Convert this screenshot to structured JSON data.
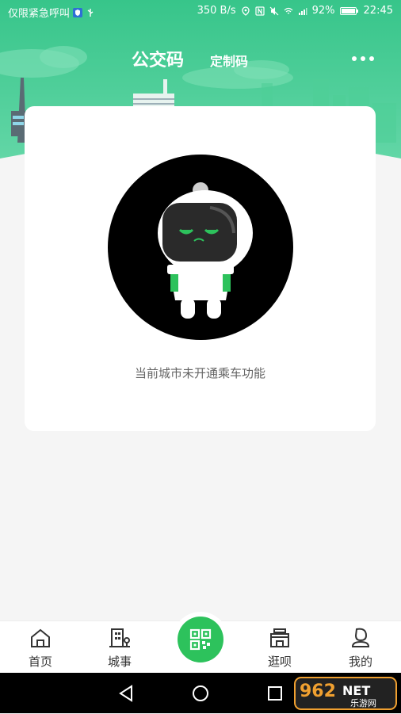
{
  "status_bar": {
    "carrier_text": "仅限紧急呼叫",
    "network_speed": "350 B/s",
    "battery": "92%",
    "time": "22:45"
  },
  "header": {
    "title": "公交码",
    "subtitle": "定制码"
  },
  "card": {
    "message": "当前城市未开通乘车功能"
  },
  "tabs": [
    {
      "label": "首页",
      "icon": "home-icon"
    },
    {
      "label": "城事",
      "icon": "building-icon"
    },
    {
      "label": "",
      "icon": "qr-code-icon"
    },
    {
      "label": "逛呗",
      "icon": "shop-icon"
    },
    {
      "label": "我的",
      "icon": "profile-icon"
    }
  ],
  "watermark": {
    "number": "962",
    "suffix": "NET",
    "sub": "乐游网"
  },
  "colors": {
    "header_green": "#3ec98a",
    "accent_green": "#2dc25c",
    "text_gray": "#666666"
  }
}
